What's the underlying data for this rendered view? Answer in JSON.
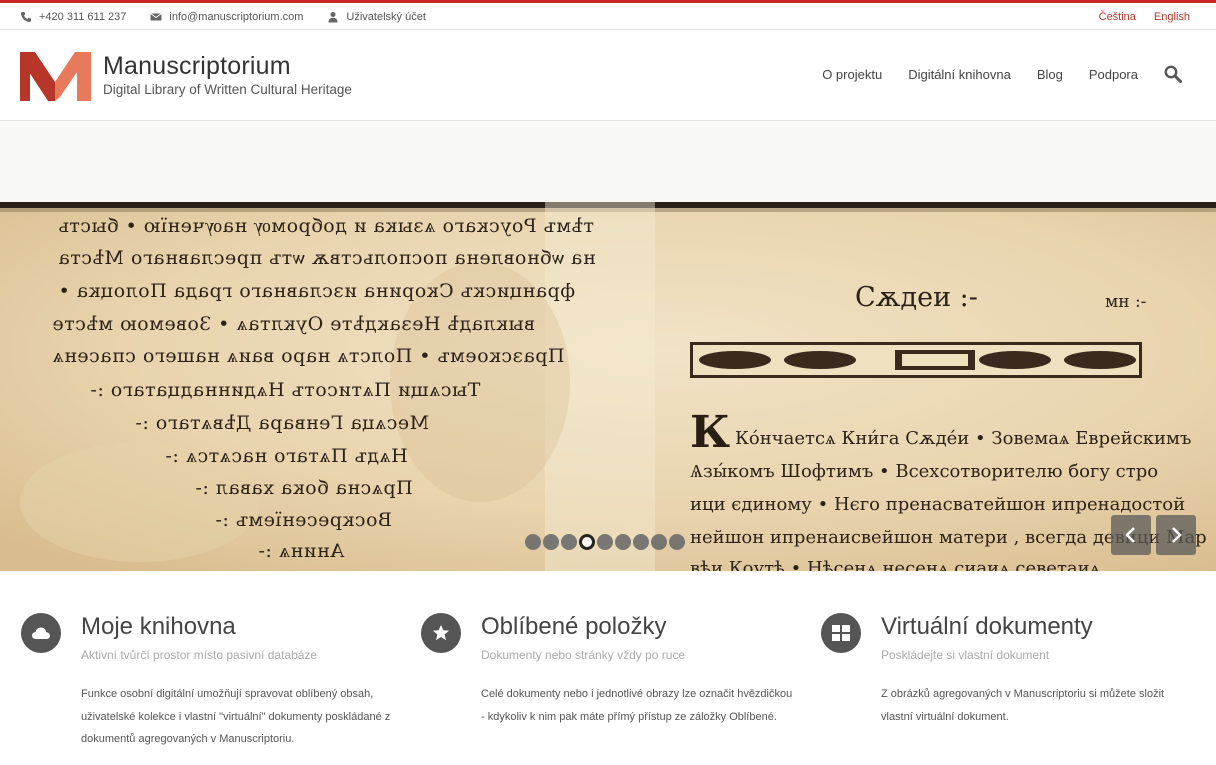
{
  "topbar": {
    "phone": "+420 311 611 237",
    "email": "info@manuscriptorium.com",
    "account": "Uživatelský účet",
    "languages": [
      "Čeština",
      "English"
    ]
  },
  "header": {
    "logo_title": "Manuscriptorium",
    "logo_subtitle": "Digital Library of Written Cultural Heritage",
    "nav": [
      "O projektu",
      "Digitální knihovna",
      "Blog",
      "Podpora"
    ]
  },
  "slider": {
    "dot_count": 9,
    "active_dot": 4,
    "manuscript_heading": "Сѫдеи :-",
    "manuscript_page_mark": "мн :-",
    "manuscript_right_lines": [
      "Ко́нчаетсѧ Кни́га Сѫде́и • Зовемаѧ Еврейскимъ",
      "Ѧзы́комъ Шофтимъ • Всехсотворителю богу стро",
      "ици єдиному • Нєго пренасватейшон ипренадостой",
      "нейшон ипренаисвейшон матери , всегда девици Мар",
      "вѣи Коутѣ • Нѣсенѧ несенѧ сиаиѧ севетаиѧ"
    ],
    "manuscript_left_lines": [
      "тѣмъ Роускаго ѧзыка и добромѹ наѹченїю • бысть",
      "на ѡбновлена поспольствѫ ѡтъ преславнаго Мѣста",
      "францискъ Скорина изславнаго града Полоцка •",
      "выкладѣ Незакдѣте Оуклтаѧ • Зовемою мѣсте",
      "Празскоемъ • Полстѧ наро ваиѧ нашего спасенѧ",
      "Тысѧщи Пѧтисотъ Нѧдиннадцатаго :-",
      "Месѧца Генвара Дѣвѧтаго :-",
      "Нѧдъ Пѧтаго насѧтсѧ :-",
      "Прѧсна бока хавал :-",
      "Воскресенїемъ :-",
      "Анинѧ :-"
    ]
  },
  "features": [
    {
      "icon": "cloud-icon",
      "title": "Moje knihovna",
      "subtitle": "Aktivní tvůrčí prostor místo pasivní databáze",
      "desc": "Funkce osobní digitální umožňují spravovat oblíbený obsah, uživatelské kolekce i vlastní \"virtuální\" dokumenty poskládané z dokumentů agregovaných v Manuscriptoriu."
    },
    {
      "icon": "star-icon",
      "title": "Oblíbené položky",
      "subtitle": "Dokumenty nebo stránky vždy po ruce",
      "desc": "Celé dokumenty nebo i jednotlivé obrazy lze označit hvězdičkou - kdykoliv k nim pak máte přímý přístup ze záložky Oblíbené."
    },
    {
      "icon": "grid-icon",
      "title": "Virtuální dokumenty",
      "subtitle": "Poskládejte si vlastní dokument",
      "desc": "Z obrázků agregovaných v Manuscriptoriu si můžete složit vlastní virtuální dokument."
    }
  ],
  "colors": {
    "accent": "#c62828",
    "logo_dark": "#b8352a",
    "logo_light": "#e8795a",
    "icon_bg": "#555555"
  }
}
